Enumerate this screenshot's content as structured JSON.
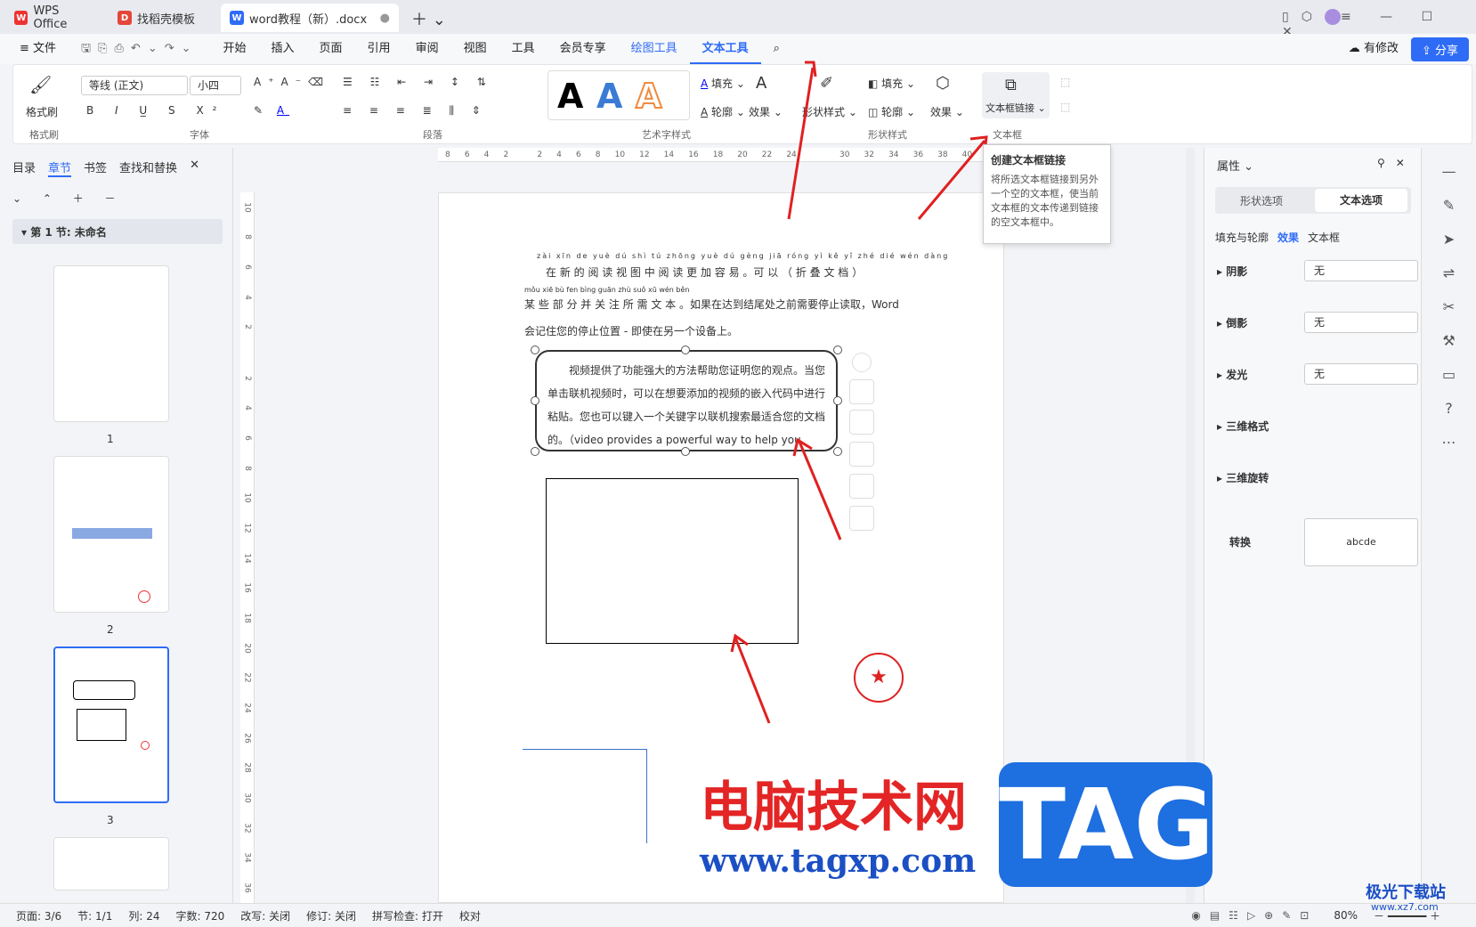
{
  "titlebar": {
    "tabs": [
      "WPS Office",
      "找稻壳模板",
      "word教程（新）.docx"
    ]
  },
  "menu": {
    "file": "文件",
    "items": [
      "开始",
      "插入",
      "页面",
      "引用",
      "审阅",
      "视图",
      "工具",
      "会员专享"
    ],
    "draw": "绘图工具",
    "text": "文本工具",
    "modify": "有修改",
    "share": "分享"
  },
  "ribbon": {
    "format_painter": "格式刷",
    "font": "等线 (正文)",
    "size": "小四",
    "groups": [
      "格式刷",
      "字体",
      "段落",
      "艺术字样式",
      "形状样式",
      "文本框"
    ],
    "fill": "填充",
    "outline": "轮廓",
    "effect": "效果",
    "shape_style": "形状样式",
    "textbox_link": "文本框链接"
  },
  "tooltip": {
    "title": "创建文本框链接",
    "body": "将所选文本框链接到另外一个空的文本框，使当前文本框的文本传递到链接的空文本框中。"
  },
  "left": {
    "tabs": [
      "目录",
      "章节",
      "书签",
      "查找和替换"
    ],
    "section": "第 1 节: 未命名",
    "pages": [
      "1",
      "2",
      "3"
    ]
  },
  "doc": {
    "pinyin": "zài xīn de yuè dú shì tú zhōng yuè dú gèng jiā róng yì kě yǐ zhé dié wén dàng",
    "line1": "在 新 的 阅 读 视 图 中 阅 读 更 加 容 易 。可 以 （ 折 叠 文 档 ）",
    "pinyin2": "mǒu xiē bù fen bìng guān zhù suǒ xū wén běn",
    "line2": "某 些 部 分 并 关 注 所 需 文 本 。如果在达到结尾处之前需要停止读取，Word",
    "line3": "会记住您的停止位置 - 即使在另一个设备上。",
    "textbox": "视频提供了功能强大的方法帮助您证明您的观点。当您单击联机视频时，可以在想要添加的视频的嵌入代码中进行粘贴。您也可以键入一个关键字以联机搜索最适合您的文档的。（video provides a powerful way to help you"
  },
  "right": {
    "title": "属性",
    "tabs": [
      "形状选项",
      "文本选项"
    ],
    "subtabs": [
      "填充与轮廓",
      "效果",
      "文本框"
    ],
    "rows": [
      "阴影",
      "倒影",
      "发光",
      "三维格式",
      "三维旋转"
    ],
    "none": "无",
    "transform": "转换",
    "abcde": "abcde"
  },
  "status": {
    "items": [
      "页面: 3/6",
      "节: 1/1",
      "列: 24",
      "字数: 720",
      "改写: 关闭",
      "修订: 关闭",
      "拼写检查: 打开",
      "校对"
    ],
    "zoom": "80%"
  },
  "watermark": {
    "cn": "电脑技术网",
    "url": "www.tagxp.com",
    "tag": "TAG",
    "site": "极光下载站",
    "site_url": "www.xz7.com"
  },
  "ruler": {
    "h": [
      "8",
      "6",
      "4",
      "2",
      "",
      "2",
      "4",
      "6",
      "8",
      "10",
      "12",
      "14",
      "16",
      "18",
      "20",
      "22",
      "24",
      "",
      "",
      "30",
      "32",
      "34",
      "36",
      "38",
      "40",
      "42"
    ],
    "v": [
      "10",
      "8",
      "6",
      "4",
      "2",
      "",
      "2",
      "4",
      "6",
      "8",
      "10",
      "12",
      "14",
      "16",
      "18",
      "20",
      "22",
      "24",
      "26",
      "28",
      "30",
      "32",
      "34",
      "36"
    ]
  }
}
